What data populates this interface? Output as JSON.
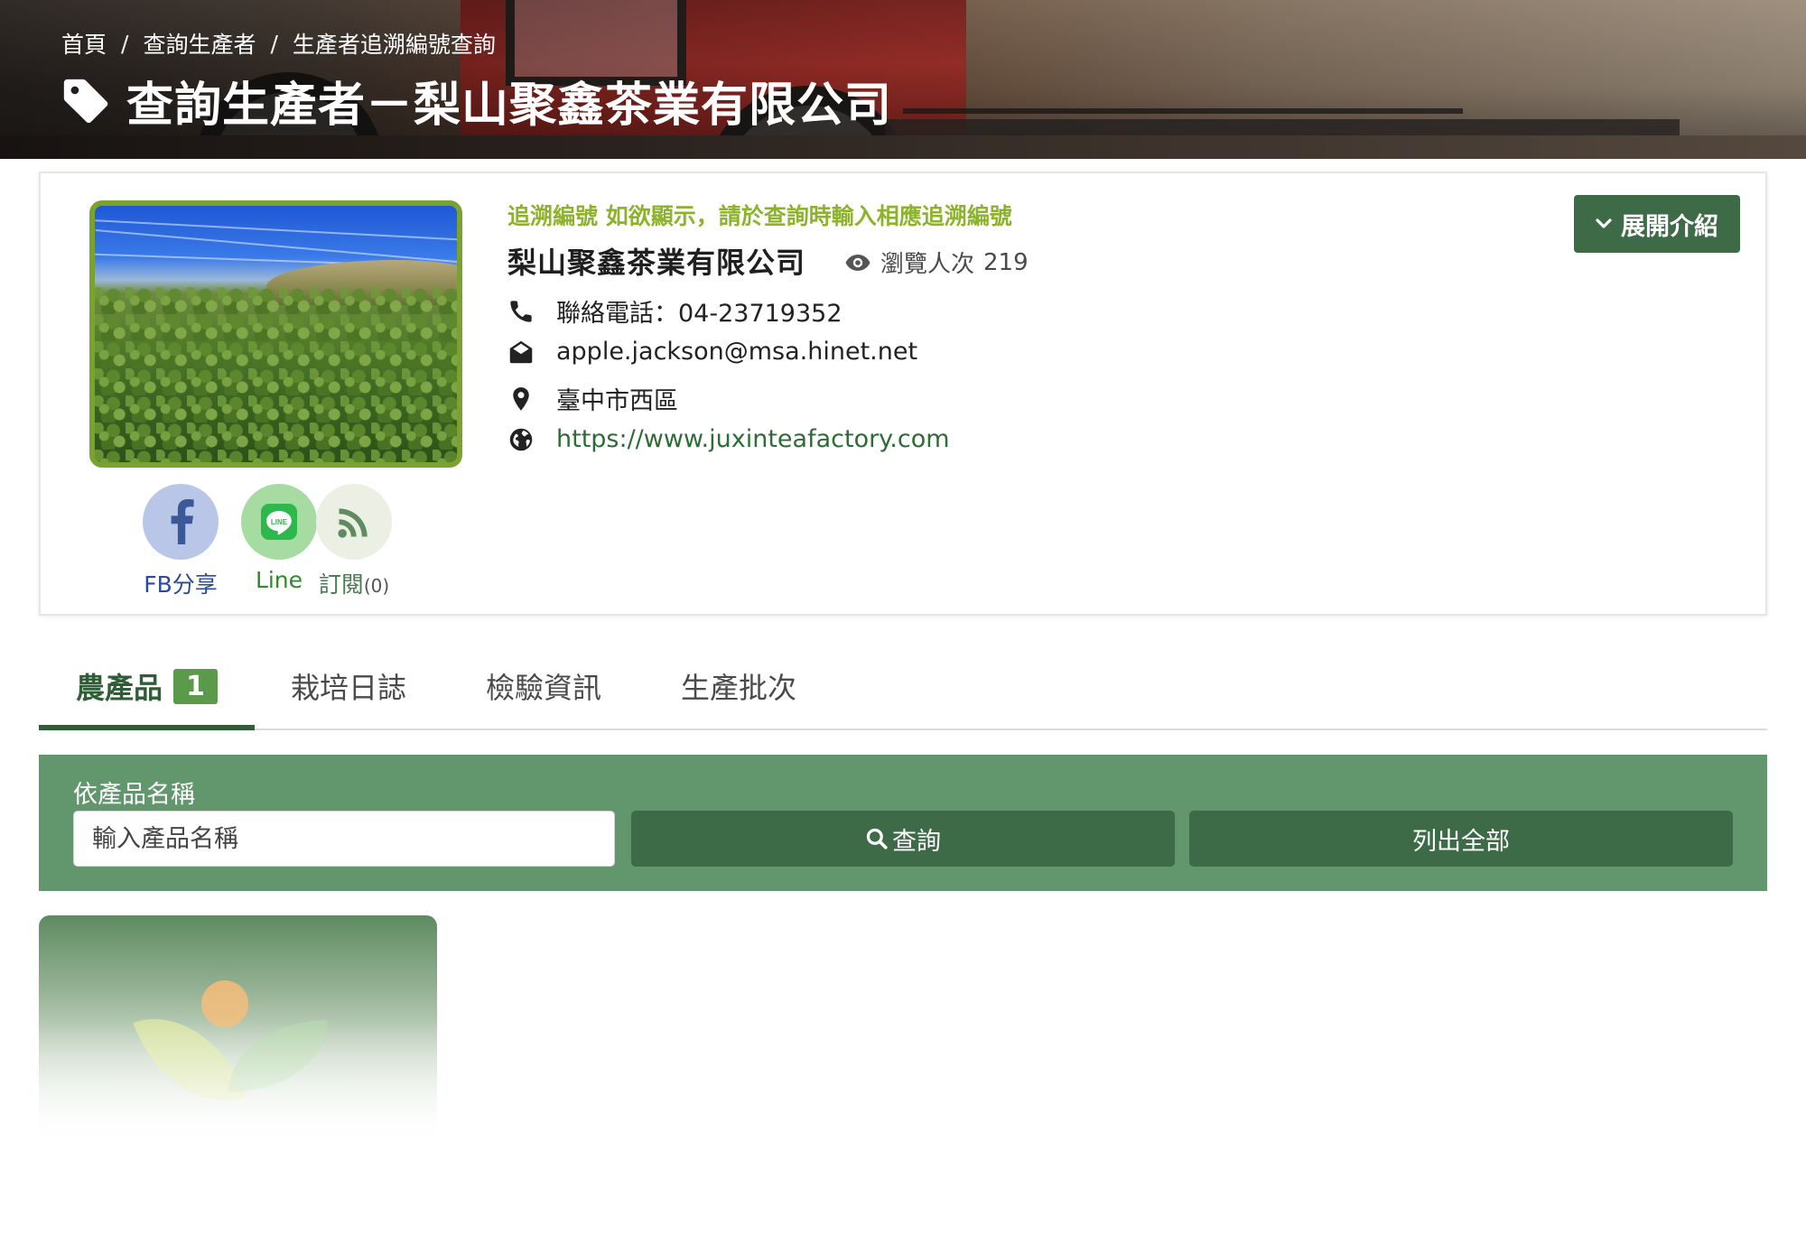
{
  "breadcrumb": [
    "首頁",
    "查詢生產者",
    "生產者追溯編號查詢"
  ],
  "page_title": "查詢生產者－梨山聚鑫茶業有限公司",
  "producer": {
    "trace_note": "追溯編號 如欲顯示，請於查詢時輸入相應追溯編號",
    "name": "梨山聚鑫茶業有限公司",
    "views_label": "瀏覽人次",
    "views_count": "219",
    "phone": "聯絡電話：04-23719352",
    "email": "apple.jackson@msa.hinet.net",
    "address": "臺中市西區",
    "website": "https://www.juxinteafactory.com",
    "expand_label": "展開介紹"
  },
  "social": {
    "fb_label": "FB分享",
    "line_label": "Line",
    "line_icon_text": "LINE",
    "rss_label": "訂閱",
    "rss_count": "(0)"
  },
  "tabs": [
    {
      "label": "農產品",
      "count": "1",
      "active": true
    },
    {
      "label": "栽培日誌"
    },
    {
      "label": "檢驗資訊"
    },
    {
      "label": "生產批次"
    }
  ],
  "search": {
    "label": "依產品名稱",
    "placeholder": "輸入產品名稱",
    "search_button": "查詢",
    "list_all_button": "列出全部"
  },
  "colors": {
    "brand_green": "#3d6b47",
    "panel_green": "#62966c",
    "accent_lime": "#8db32c",
    "badge_green": "#5b9a4a"
  }
}
